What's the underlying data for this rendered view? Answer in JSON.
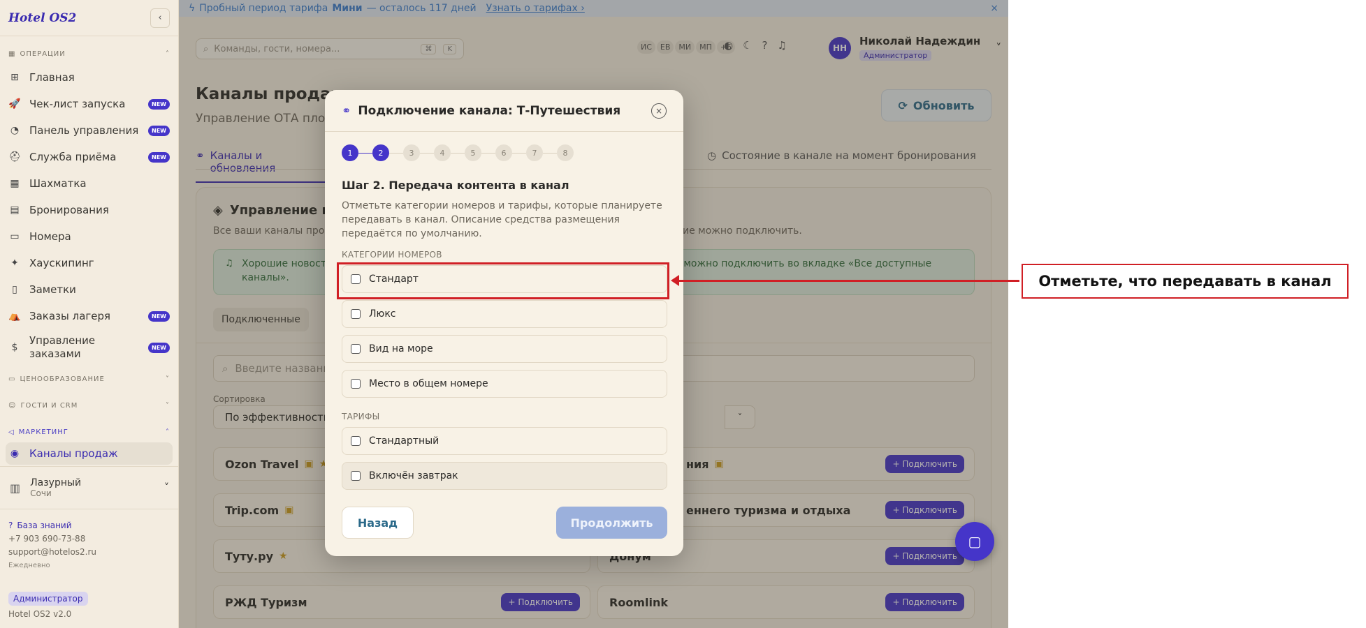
{
  "app": {
    "logo": "Hotel OS2"
  },
  "banner": {
    "text_prefix": "Пробный период тарифа",
    "plan": "Мини",
    "text_suffix": "— осталось 117 дней",
    "link": "Узнать о тарифах ›",
    "close": "×"
  },
  "header": {
    "search_placeholder": "Команды, гости, номера...",
    "kbd1": "⌘",
    "kbd2": "K",
    "avatars": [
      "ИС",
      "ЕВ",
      "МИ",
      "МП",
      "+5"
    ],
    "user_initials": "НН",
    "user_name": "Николай Надеждин",
    "user_role": "Администратор"
  },
  "sidebar": {
    "sections": {
      "operations": "ОПЕРАЦИИ",
      "pricing": "ЦЕНООБРАЗОВАНИЕ",
      "guests": "ГОСТИ И CRM",
      "marketing": "МАРКЕТИНГ"
    },
    "new_badge": "NEW",
    "items": [
      {
        "label": "Главная",
        "icon": "⊞"
      },
      {
        "label": "Чек-лист запуска",
        "icon": "🚀"
      },
      {
        "label": "Панель управления",
        "icon": "◔"
      },
      {
        "label": "Служба приёма",
        "icon": "⛑"
      },
      {
        "label": "Шахматка",
        "icon": "▦"
      },
      {
        "label": "Бронирования",
        "icon": "▤"
      },
      {
        "label": "Номера",
        "icon": "▭"
      },
      {
        "label": "Хаускипинг",
        "icon": "✦"
      },
      {
        "label": "Заметки",
        "icon": "▯"
      },
      {
        "label": "Заказы лагеря",
        "icon": "⛺"
      },
      {
        "label": "Управление заказами",
        "icon": "$"
      }
    ],
    "active_item": "Каналы продаж",
    "hotel_name": "Лазурный",
    "hotel_city": "Сочи",
    "kb_label": "База знаний",
    "phone": "+7 903 690-73-88",
    "email": "support@hotelos2.ru",
    "daily": "Ежедневно",
    "role": "Администратор",
    "version": "Hotel OS2 v2.0"
  },
  "main": {
    "title": "Каналы продаж",
    "subtitle": "Управление ОТА площадками",
    "refresh": "Обновить",
    "tab1": "Каналы и обновления",
    "tab2": "Состояние в канале на момент бронирования",
    "card_title": "Управление каналами",
    "card_sub": "Все ваши каналы продаж",
    "card_sub2": "ие можно подключить.",
    "notice_1": "Хорошие новост",
    "notice_2": "каналы».",
    "notice_3": "го можно подключить во вкладке «Все доступные",
    "pill": "Подключенные",
    "search_placeholder": "Введите названи",
    "sort_label": "Сортировка",
    "sort_value": "По эффективности",
    "connect": "+ Подключить",
    "channels_left": [
      "Ozon Travel",
      "Trip.com",
      "Туту.ру",
      "РЖД Туризм"
    ],
    "channels_right": [
      "ния",
      "еннего туризма и отдыха",
      "Донум",
      "Roomlink"
    ]
  },
  "modal": {
    "title": "Подключение канала: Т-Путешествия",
    "steps": [
      "1",
      "2",
      "3",
      "4",
      "5",
      "6",
      "7",
      "8"
    ],
    "step_title": "Шаг 2. Передача контента в канал",
    "description": "Отметьте категории номеров и тарифы, которые планируете передавать в канал. Описание средства размещения передаётся по умолчанию.",
    "rooms_section": "КАТЕГОРИИ НОМЕРОВ",
    "rooms": [
      "Стандарт",
      "Люкс",
      "Вид на море",
      "Место в общем номере"
    ],
    "rates_section": "ТАРИФЫ",
    "rates": [
      "Стандартный",
      "Включён завтрак"
    ],
    "back": "Назад",
    "continue": "Продолжить"
  },
  "callout": {
    "text": "Отметьте, что передавать в канал"
  },
  "colors": {
    "accent": "#4535c9",
    "highlight": "#d01f25",
    "background": "#f6efe2"
  }
}
